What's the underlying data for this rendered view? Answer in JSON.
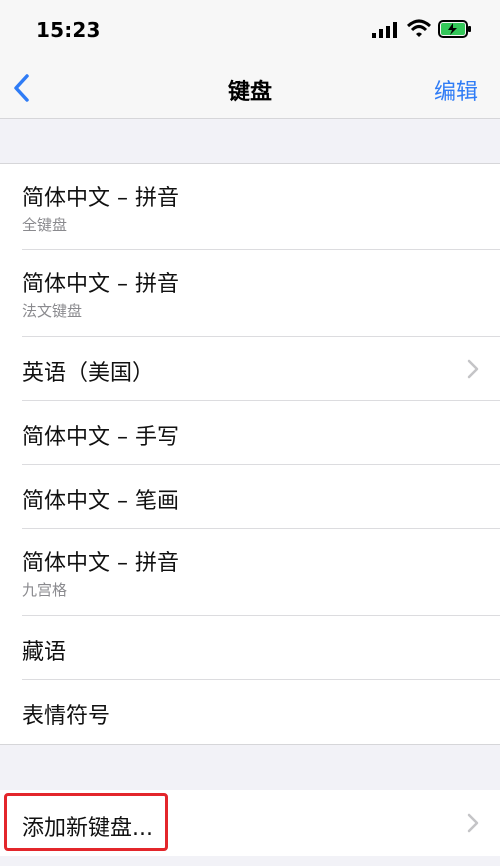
{
  "status_bar": {
    "time": "15:23",
    "icons": [
      "signal-icon",
      "wifi-icon",
      "battery-charging-icon"
    ]
  },
  "nav": {
    "back_icon": "chevron-left-icon",
    "title": "键盘",
    "edit_label": "编辑"
  },
  "keyboards": [
    {
      "title": "简体中文 – 拼音",
      "subtitle": "全键盘",
      "chevron": false
    },
    {
      "title": "简体中文 – 拼音",
      "subtitle": "法文键盘",
      "chevron": false
    },
    {
      "title": "英语（美国）",
      "subtitle": "",
      "chevron": true
    },
    {
      "title": "简体中文 – 手写",
      "subtitle": "",
      "chevron": false
    },
    {
      "title": "简体中文 – 笔画",
      "subtitle": "",
      "chevron": false
    },
    {
      "title": "简体中文 – 拼音",
      "subtitle": "九宫格",
      "chevron": false
    },
    {
      "title": "藏语",
      "subtitle": "",
      "chevron": false
    },
    {
      "title": "表情符号",
      "subtitle": "",
      "chevron": false
    }
  ],
  "add_keyboard": {
    "label": "添加新键盘...",
    "chevron_icon": "chevron-right-icon"
  },
  "colors": {
    "accent": "#2f7cf6",
    "highlight": "#e3262b",
    "background": "#f2f2f7"
  }
}
